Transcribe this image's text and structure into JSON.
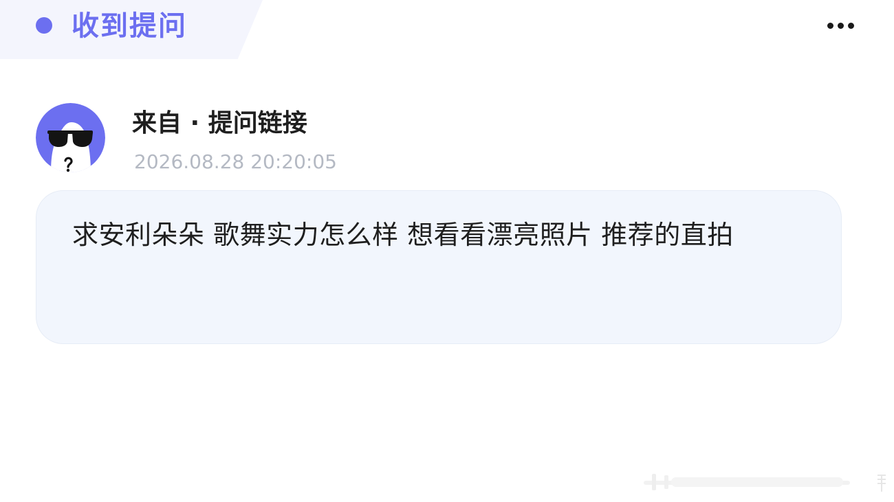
{
  "header": {
    "title": "收到提问",
    "accent_color": "#6c6ff0"
  },
  "menu": {
    "icon": "more-horizontal-icon"
  },
  "message": {
    "avatar": "sunglasses-ghost-avatar",
    "sender": "来自 · 提问链接",
    "timestamp": "2026.08.28 20:20:05",
    "question": "求安利朵朵 歌舞实力怎么样 想看看漂亮照片 推荐的直拍"
  }
}
